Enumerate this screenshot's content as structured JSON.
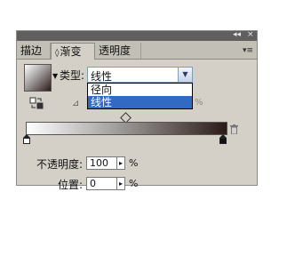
{
  "panel": {
    "title_controls": {
      "collapse": "◂◂",
      "close": "×"
    },
    "tabs": [
      {
        "label": "描边"
      },
      {
        "label": "渐变"
      },
      {
        "label": "透明度"
      }
    ],
    "menu_icon": "▾≡"
  },
  "gradient": {
    "type_label": "类型:",
    "type_value": "线性",
    "dropdown_options": [
      {
        "label": "径向",
        "selected": false
      },
      {
        "label": "线性",
        "selected": true
      }
    ],
    "hidden_percent": "%",
    "opacity_label": "不透明度:",
    "opacity_value": "100",
    "opacity_unit": "%",
    "position_label": "位置:",
    "position_value": "0",
    "position_unit": "%"
  },
  "colors": {
    "panel_bg": "#d4d0c8",
    "selection": "#316ac5",
    "gradient_start": "#ffffff",
    "gradient_end": "#2b1b18"
  },
  "icons": {
    "reverse": "reverse-gradient-icon",
    "angle": "angle-icon",
    "trash": "trash-icon",
    "midpoint": "midpoint-diamond-icon"
  }
}
